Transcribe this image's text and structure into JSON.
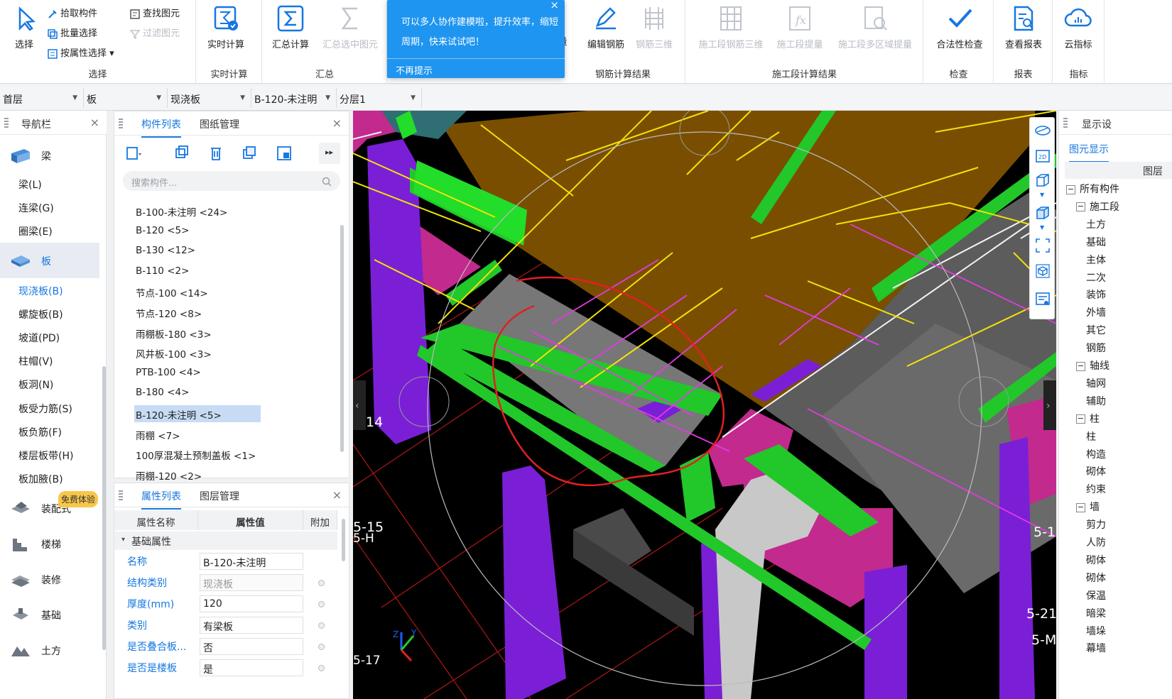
{
  "ribbon": {
    "select": {
      "label": "选择"
    },
    "pick": "拾取构件",
    "batch": "批量选择",
    "byattr": "按属性选择",
    "find": "查找图元",
    "filter": "过滤图元",
    "select_group": "选择",
    "realtime": {
      "label": "实时计算",
      "group": "实时计算"
    },
    "sum": {
      "label": "汇总计算"
    },
    "sum_sel": {
      "label": "汇总选中图元"
    },
    "sum_group": "汇总",
    "qty_partial": "量",
    "edit_rebar": "编辑钢筋",
    "rebar3d": "钢筋三维",
    "rebar_group": "钢筋计算结果",
    "stage_rebar3d": "施工段钢筋三维",
    "stage_qty": "施工段提量",
    "stage_multi": "施工段多区域提量",
    "stage_group": "施工段计算结果",
    "check": {
      "label": "合法性检查",
      "group": "检查"
    },
    "report": {
      "label": "查看报表",
      "group": "报表"
    },
    "cloud": {
      "label": "云指标",
      "group": "指标"
    }
  },
  "tooltip": {
    "text": "可以多人协作建模啦，提升效率，缩短周期，快来试试吧！",
    "dismiss": "不再提示",
    "close": "×"
  },
  "selectors": [
    "首层",
    "板",
    "现浇板",
    "B-120-未注明",
    "分层1"
  ],
  "nav": {
    "title": "导航栏",
    "close": "×",
    "categories": [
      {
        "label": "梁"
      },
      {
        "label": "板"
      },
      {
        "label": "装配式"
      },
      {
        "label": "楼梯"
      },
      {
        "label": "装修"
      },
      {
        "label": "基础"
      },
      {
        "label": "土方"
      }
    ],
    "beam_items": [
      "梁(L)",
      "连梁(G)",
      "圈梁(E)"
    ],
    "slab_items": [
      "现浇板(B)",
      "螺旋板(B)",
      "坡道(PD)",
      "柱帽(V)",
      "板洞(N)",
      "板受力筋(S)",
      "板负筋(F)",
      "楼层板带(H)",
      "板加腋(B)"
    ],
    "badge": "免费体验"
  },
  "components": {
    "tab_list": "构件列表",
    "tab_drawing": "图纸管理",
    "close": "×",
    "search_placeholder": "搜索构件...",
    "items": [
      "B-100-未注明 <24>",
      "B-120 <5>",
      "B-130 <12>",
      "B-110 <2>",
      "节点-100 <14>",
      "节点-120 <8>",
      "雨棚板-180 <3>",
      "风井板-100 <3>",
      "PTB-100 <4>",
      "B-180 <4>",
      "B-120-未注明 <5>",
      "雨棚 <7>",
      "100厚混凝土预制盖板 <1>",
      "雨棚-120 <2>"
    ],
    "selected_index": 10
  },
  "properties": {
    "tab_props": "属性列表",
    "tab_layers": "图层管理",
    "close": "×",
    "col_name": "属性名称",
    "col_value": "属性值",
    "col_extra": "附加",
    "section": "基础属性",
    "rows": [
      {
        "name": "名称",
        "value": "B-120-未注明"
      },
      {
        "name": "结构类别",
        "value": "现浇板"
      },
      {
        "name": "厚度(mm)",
        "value": "120"
      },
      {
        "name": "类别",
        "value": "有梁板"
      },
      {
        "name": "是否叠合板...",
        "value": "否"
      },
      {
        "name": "是否是楼板",
        "value": "是"
      }
    ]
  },
  "viewport": {
    "labels": [
      "14",
      "5-15",
      "5-H",
      "5-17",
      "5-21",
      "5-M",
      "5-1"
    ],
    "axis_y": "Y",
    "axis_z": "Z",
    "colors": {
      "slab": "#7a4e00",
      "beam": "#22cc22",
      "column": "#7a1fd6",
      "wall": "#d6249c",
      "gray": "#5a5a5a",
      "rebar_yellow": "#f2e20a",
      "annotation": "#e02020"
    }
  },
  "display": {
    "title": "显示设",
    "tab": "图元显示",
    "col": "图层",
    "tree": [
      {
        "t": "所有构件",
        "lvl": 0,
        "tog": "−"
      },
      {
        "t": "施工段",
        "lvl": 1,
        "tog": "−"
      },
      {
        "t": "土方",
        "lvl": 2
      },
      {
        "t": "基础",
        "lvl": 2
      },
      {
        "t": "主体",
        "lvl": 2
      },
      {
        "t": "二次",
        "lvl": 2
      },
      {
        "t": "装饰",
        "lvl": 2
      },
      {
        "t": "外墙",
        "lvl": 2
      },
      {
        "t": "其它",
        "lvl": 2
      },
      {
        "t": "钢筋",
        "lvl": 2
      },
      {
        "t": "轴线",
        "lvl": 1,
        "tog": "−"
      },
      {
        "t": "轴网",
        "lvl": 2
      },
      {
        "t": "辅助",
        "lvl": 2
      },
      {
        "t": "柱",
        "lvl": 1,
        "tog": "−"
      },
      {
        "t": "柱",
        "lvl": 2
      },
      {
        "t": "构造",
        "lvl": 2
      },
      {
        "t": "砌体",
        "lvl": 2
      },
      {
        "t": "约束",
        "lvl": 2
      },
      {
        "t": "墙",
        "lvl": 1,
        "tog": "−"
      },
      {
        "t": "剪力",
        "lvl": 2
      },
      {
        "t": "人防",
        "lvl": 2
      },
      {
        "t": "砌体",
        "lvl": 2
      },
      {
        "t": "砌体",
        "lvl": 2
      },
      {
        "t": "保温",
        "lvl": 2
      },
      {
        "t": "暗梁",
        "lvl": 2
      },
      {
        "t": "墙垛",
        "lvl": 2
      },
      {
        "t": "幕墙",
        "lvl": 2
      }
    ]
  }
}
